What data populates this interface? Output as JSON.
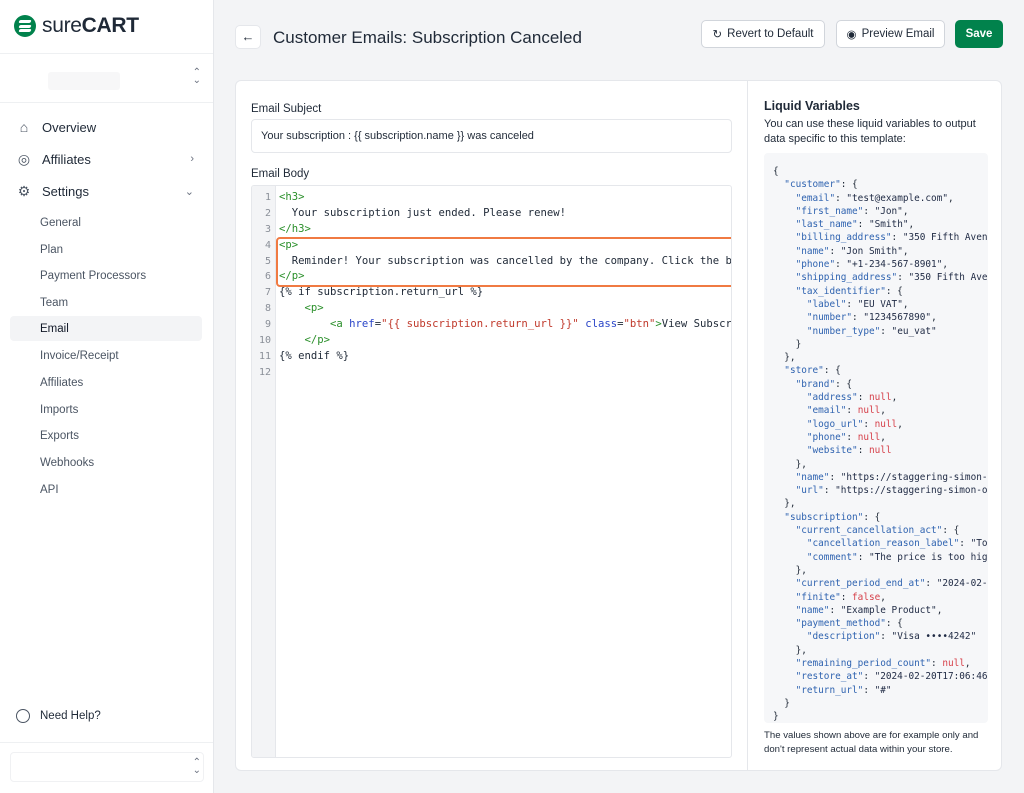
{
  "brand": {
    "name_light": "sure",
    "name_bold": "CART",
    "color": "#01824c"
  },
  "sidebar": {
    "items": [
      {
        "label": "Overview",
        "icon": "home-icon"
      },
      {
        "label": "Affiliates",
        "icon": "fingerprint-icon"
      },
      {
        "label": "Settings",
        "icon": "gear-icon"
      }
    ],
    "settings_sub": [
      "General",
      "Plan",
      "Payment Processors",
      "Team",
      "Email",
      "Invoice/Receipt",
      "Affiliates",
      "Imports",
      "Exports",
      "Webhooks",
      "API"
    ],
    "active_sub": "Email",
    "help": "Need Help?"
  },
  "header": {
    "title": "Customer Emails: Subscription Canceled",
    "revert": "Revert to Default",
    "preview": "Preview Email",
    "save": "Save"
  },
  "form": {
    "subject_label": "Email Subject",
    "subject_value": "Your subscription : {{ subscription.name }} was canceled",
    "body_label": "Email Body",
    "body_lines": [
      [
        [
          "tag",
          "<h3>"
        ]
      ],
      [
        [
          "txt",
          "  Your subscription just ended. Please renew!"
        ]
      ],
      [
        [
          "tag",
          "</h3>"
        ]
      ],
      [
        [
          "tag",
          "<p>"
        ]
      ],
      [
        [
          "txt",
          "  Reminder! Your subscription was cancelled by the company. Click the b"
        ]
      ],
      [
        [
          "tag",
          "</p>"
        ]
      ],
      [
        [
          "txt",
          "{% if subscription.return_url %}"
        ]
      ],
      [
        [
          "txt",
          "    "
        ],
        [
          "tag",
          "<p>"
        ]
      ],
      [
        [
          "txt",
          "        "
        ],
        [
          "tag",
          "<a "
        ],
        [
          "attr",
          "href"
        ],
        [
          "txt",
          "="
        ],
        [
          "val",
          "\"{{ subscription.return_url }}\""
        ],
        [
          "txt",
          " "
        ],
        [
          "attr",
          "class"
        ],
        [
          "txt",
          "="
        ],
        [
          "val",
          "\"btn\""
        ],
        [
          "tag",
          ">"
        ],
        [
          "txt",
          "View Subscr"
        ]
      ],
      [
        [
          "txt",
          "    "
        ],
        [
          "tag",
          "</p>"
        ]
      ],
      [
        [
          "txt",
          "{% endif %}"
        ]
      ],
      []
    ],
    "highlight_color": "#f07a42"
  },
  "liquid": {
    "title": "Liquid Variables",
    "description": "You can use these liquid variables to output data specific to this template:",
    "note": "The values shown above are for example only and don't represent actual data within your store.",
    "lines": [
      [
        [
          "p",
          "{"
        ]
      ],
      [
        [
          "p",
          "  "
        ],
        [
          "k",
          "\"customer\""
        ],
        [
          "p",
          ": {"
        ]
      ],
      [
        [
          "p",
          "    "
        ],
        [
          "k",
          "\"email\""
        ],
        [
          "p",
          ": "
        ],
        [
          "s",
          "\"test@example.com\""
        ],
        [
          "p",
          ","
        ]
      ],
      [
        [
          "p",
          "    "
        ],
        [
          "k",
          "\"first_name\""
        ],
        [
          "p",
          ": "
        ],
        [
          "s",
          "\"Jon\""
        ],
        [
          "p",
          ","
        ]
      ],
      [
        [
          "p",
          "    "
        ],
        [
          "k",
          "\"last_name\""
        ],
        [
          "p",
          ": "
        ],
        [
          "s",
          "\"Smith\""
        ],
        [
          "p",
          ","
        ]
      ],
      [
        [
          "p",
          "    "
        ],
        [
          "k",
          "\"billing_address\""
        ],
        [
          "p",
          ": "
        ],
        [
          "s",
          "\"350 Fifth Aven"
        ]
      ],
      [
        [
          "p",
          "    "
        ],
        [
          "k",
          "\"name\""
        ],
        [
          "p",
          ": "
        ],
        [
          "s",
          "\"Jon Smith\""
        ],
        [
          "p",
          ","
        ]
      ],
      [
        [
          "p",
          "    "
        ],
        [
          "k",
          "\"phone\""
        ],
        [
          "p",
          ": "
        ],
        [
          "s",
          "\"+1-234-567-8901\""
        ],
        [
          "p",
          ","
        ]
      ],
      [
        [
          "p",
          "    "
        ],
        [
          "k",
          "\"shipping_address\""
        ],
        [
          "p",
          ": "
        ],
        [
          "s",
          "\"350 Fifth Ave"
        ]
      ],
      [
        [
          "p",
          "    "
        ],
        [
          "k",
          "\"tax_identifier\""
        ],
        [
          "p",
          ": {"
        ]
      ],
      [
        [
          "p",
          "      "
        ],
        [
          "k",
          "\"label\""
        ],
        [
          "p",
          ": "
        ],
        [
          "s",
          "\"EU VAT\""
        ],
        [
          "p",
          ","
        ]
      ],
      [
        [
          "p",
          "      "
        ],
        [
          "k",
          "\"number\""
        ],
        [
          "p",
          ": "
        ],
        [
          "s",
          "\"1234567890\""
        ],
        [
          "p",
          ","
        ]
      ],
      [
        [
          "p",
          "      "
        ],
        [
          "k",
          "\"number_type\""
        ],
        [
          "p",
          ": "
        ],
        [
          "s",
          "\"eu_vat\""
        ]
      ],
      [
        [
          "p",
          "    }"
        ]
      ],
      [
        [
          "p",
          "  },"
        ]
      ],
      [
        [
          "p",
          "  "
        ],
        [
          "k",
          "\"store\""
        ],
        [
          "p",
          ": {"
        ]
      ],
      [
        [
          "p",
          "    "
        ],
        [
          "k",
          "\"brand\""
        ],
        [
          "p",
          ": {"
        ]
      ],
      [
        [
          "p",
          "      "
        ],
        [
          "k",
          "\"address\""
        ],
        [
          "p",
          ": "
        ],
        [
          "n",
          "null"
        ],
        [
          "p",
          ","
        ]
      ],
      [
        [
          "p",
          "      "
        ],
        [
          "k",
          "\"email\""
        ],
        [
          "p",
          ": "
        ],
        [
          "n",
          "null"
        ],
        [
          "p",
          ","
        ]
      ],
      [
        [
          "p",
          "      "
        ],
        [
          "k",
          "\"logo_url\""
        ],
        [
          "p",
          ": "
        ],
        [
          "n",
          "null"
        ],
        [
          "p",
          ","
        ]
      ],
      [
        [
          "p",
          "      "
        ],
        [
          "k",
          "\"phone\""
        ],
        [
          "p",
          ": "
        ],
        [
          "n",
          "null"
        ],
        [
          "p",
          ","
        ]
      ],
      [
        [
          "p",
          "      "
        ],
        [
          "k",
          "\"website\""
        ],
        [
          "p",
          ": "
        ],
        [
          "n",
          "null"
        ]
      ],
      [
        [
          "p",
          "    },"
        ]
      ],
      [
        [
          "p",
          "    "
        ],
        [
          "k",
          "\"name\""
        ],
        [
          "p",
          ": "
        ],
        [
          "s",
          "\"https://staggering-simon-"
        ]
      ],
      [
        [
          "p",
          "    "
        ],
        [
          "k",
          "\"url\""
        ],
        [
          "p",
          ": "
        ],
        [
          "s",
          "\"https://staggering-simon-o"
        ]
      ],
      [
        [
          "p",
          "  },"
        ]
      ],
      [
        [
          "p",
          "  "
        ],
        [
          "k",
          "\"subscription\""
        ],
        [
          "p",
          ": {"
        ]
      ],
      [
        [
          "p",
          "    "
        ],
        [
          "k",
          "\"current_cancellation_act\""
        ],
        [
          "p",
          ": {"
        ]
      ],
      [
        [
          "p",
          "      "
        ],
        [
          "k",
          "\"cancellation_reason_label\""
        ],
        [
          "p",
          ": "
        ],
        [
          "s",
          "\"To"
        ]
      ],
      [
        [
          "p",
          "      "
        ],
        [
          "k",
          "\"comment\""
        ],
        [
          "p",
          ": "
        ],
        [
          "s",
          "\"The price is too hig"
        ]
      ],
      [
        [
          "p",
          "    },"
        ]
      ],
      [
        [
          "p",
          "    "
        ],
        [
          "k",
          "\"current_period_end_at\""
        ],
        [
          "p",
          ": "
        ],
        [
          "s",
          "\"2024-02-"
        ]
      ],
      [
        [
          "p",
          "    "
        ],
        [
          "k",
          "\"finite\""
        ],
        [
          "p",
          ": "
        ],
        [
          "n",
          "false"
        ],
        [
          "p",
          ","
        ]
      ],
      [
        [
          "p",
          "    "
        ],
        [
          "k",
          "\"name\""
        ],
        [
          "p",
          ": "
        ],
        [
          "s",
          "\"Example Product\""
        ],
        [
          "p",
          ","
        ]
      ],
      [
        [
          "p",
          "    "
        ],
        [
          "k",
          "\"payment_method\""
        ],
        [
          "p",
          ": {"
        ]
      ],
      [
        [
          "p",
          "      "
        ],
        [
          "k",
          "\"description\""
        ],
        [
          "p",
          ": "
        ],
        [
          "s",
          "\"Visa ••••4242\""
        ]
      ],
      [
        [
          "p",
          "    },"
        ]
      ],
      [
        [
          "p",
          "    "
        ],
        [
          "k",
          "\"remaining_period_count\""
        ],
        [
          "p",
          ": "
        ],
        [
          "n",
          "null"
        ],
        [
          "p",
          ","
        ]
      ],
      [
        [
          "p",
          "    "
        ],
        [
          "k",
          "\"restore_at\""
        ],
        [
          "p",
          ": "
        ],
        [
          "s",
          "\"2024-02-20T17:06:46"
        ]
      ],
      [
        [
          "p",
          "    "
        ],
        [
          "k",
          "\"return_url\""
        ],
        [
          "p",
          ": "
        ],
        [
          "s",
          "\"#\""
        ]
      ],
      [
        [
          "p",
          "  }"
        ]
      ],
      [
        [
          "p",
          "}"
        ]
      ]
    ]
  }
}
